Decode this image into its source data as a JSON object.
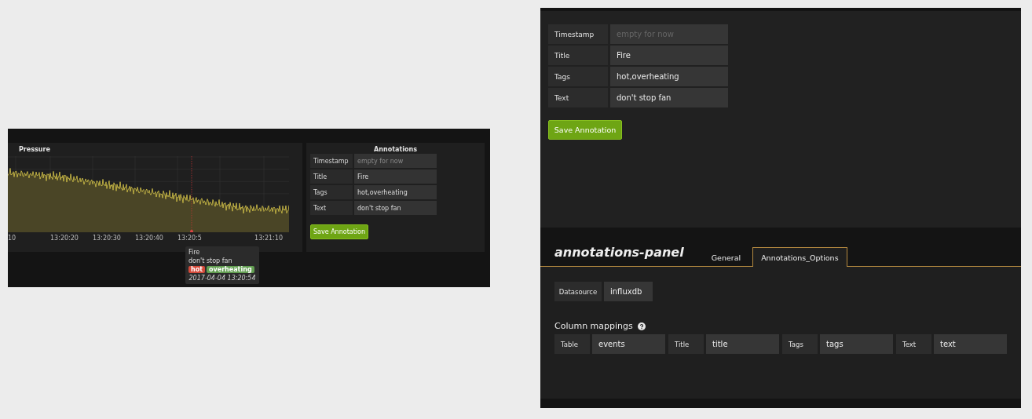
{
  "dashboard_screenshot": {
    "graph_panel": {
      "title": "Pressure",
      "x_tick_labels": [
        "10",
        "13:20:20",
        "13:20:30",
        "13:20:40",
        "13:20:5",
        "13:21:10"
      ]
    },
    "tooltip": {
      "title": "Fire",
      "text": "don't stop fan",
      "tags": [
        {
          "label": "hot",
          "color": "#d44a3a"
        },
        {
          "label": "overheating",
          "color": "#629e51"
        }
      ],
      "time": "2017-04-04 13:20:54"
    },
    "annotations_panel": {
      "title": "Annotations",
      "fields": [
        {
          "label": "Timestamp",
          "placeholder": "empty for now"
        },
        {
          "label": "Title",
          "value": "Fire"
        },
        {
          "label": "Tags",
          "value": "hot,overheating"
        },
        {
          "label": "Text",
          "value": "don't stop fan"
        }
      ],
      "save_button": "Save Annotation"
    }
  },
  "editor_screenshot": {
    "fields": [
      {
        "label": "Timestamp",
        "placeholder": "empty for now"
      },
      {
        "label": "Title",
        "value": "Fire"
      },
      {
        "label": "Tags",
        "value": "hot,overheating"
      },
      {
        "label": "Text",
        "value": "don't stop fan"
      }
    ],
    "save_button": "Save Annotation",
    "panel_title": "annotations-panel",
    "tabs": [
      {
        "label": "General",
        "selected": false
      },
      {
        "label": "Annotations_Options",
        "selected": true
      }
    ],
    "datasource": {
      "label": "Datasource",
      "value": "influxdb"
    },
    "column_mappings": {
      "title": "Column mappings",
      "items": [
        {
          "label": "Table",
          "value": "events"
        },
        {
          "label": "Title",
          "value": "title"
        },
        {
          "label": "Tags",
          "value": "tags"
        },
        {
          "label": "Text",
          "value": "text"
        }
      ]
    }
  }
}
